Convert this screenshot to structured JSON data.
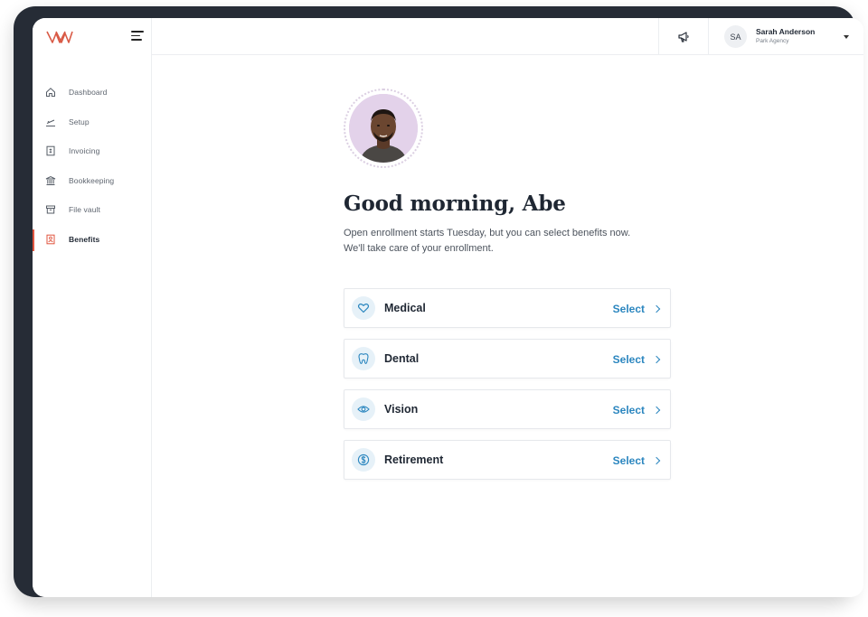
{
  "sidebar": {
    "logo": "W-logo",
    "items": [
      {
        "label": "Dashboard",
        "icon": "home-icon",
        "active": false
      },
      {
        "label": "Setup",
        "icon": "plane-icon",
        "active": false
      },
      {
        "label": "Invoicing",
        "icon": "invoice-icon",
        "active": false
      },
      {
        "label": "Bookkeeping",
        "icon": "bank-icon",
        "active": false
      },
      {
        "label": "File vault",
        "icon": "archive-icon",
        "active": false
      },
      {
        "label": "Benefits",
        "icon": "benefits-icon",
        "active": true
      }
    ]
  },
  "header": {
    "announcement_icon": "megaphone-icon",
    "user": {
      "initials": "SA",
      "name": "Sarah Anderson",
      "organization": "Park Agency"
    }
  },
  "main": {
    "greeting": "Good morning, Abe",
    "subtext_line1": "Open enrollment starts Tuesday, but you can select benefits now.",
    "subtext_line2": "We'll take care of your enrollment.",
    "benefits": [
      {
        "name": "Medical",
        "icon": "heart-icon",
        "action": "Select"
      },
      {
        "name": "Dental",
        "icon": "tooth-icon",
        "action": "Select"
      },
      {
        "name": "Vision",
        "icon": "eye-icon",
        "action": "Select"
      },
      {
        "name": "Retirement",
        "icon": "dollar-icon",
        "action": "Select"
      }
    ]
  },
  "colors": {
    "accent": "#e0553f",
    "link": "#2b86bf",
    "icon_bg": "#e6f1f8",
    "device_frame": "#262c36"
  }
}
